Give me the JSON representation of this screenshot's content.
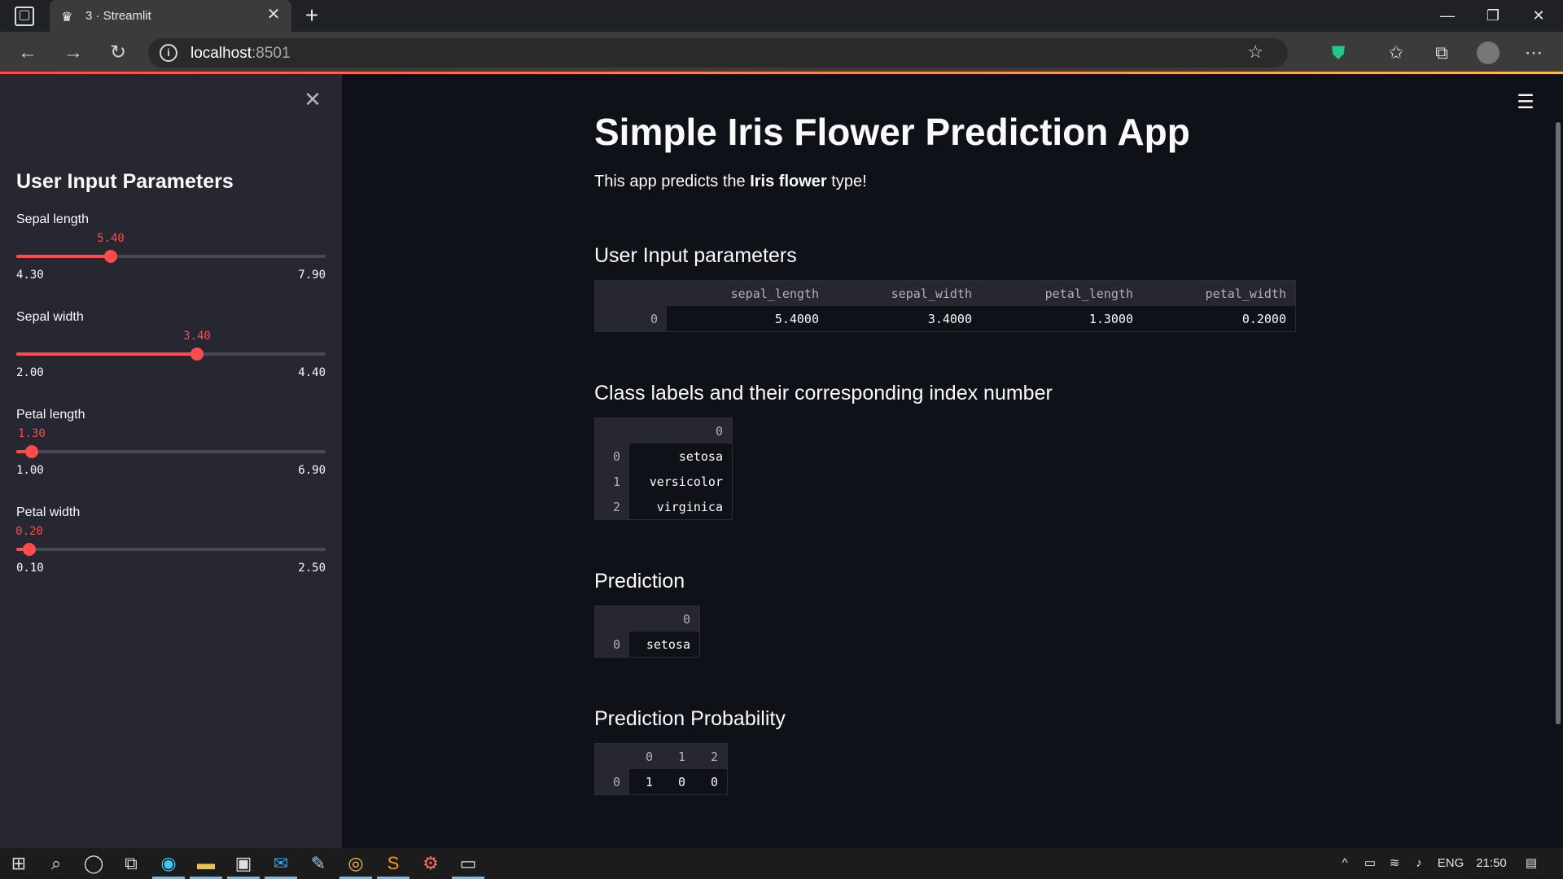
{
  "browser": {
    "tab_title": "3 · Streamlit",
    "url_host": "localhost",
    "url_port": ":8501"
  },
  "sidebar": {
    "title": "User Input Parameters",
    "sliders": [
      {
        "label": "Sepal length",
        "value": "5.40",
        "min": "4.30",
        "max": "7.90",
        "fraction": 0.306
      },
      {
        "label": "Sepal width",
        "value": "3.40",
        "min": "2.00",
        "max": "4.40",
        "fraction": 0.583
      },
      {
        "label": "Petal length",
        "value": "1.30",
        "min": "1.00",
        "max": "6.90",
        "fraction": 0.051
      },
      {
        "label": "Petal width",
        "value": "0.20",
        "min": "0.10",
        "max": "2.50",
        "fraction": 0.042
      }
    ]
  },
  "main": {
    "title": "Simple Iris Flower Prediction App",
    "intro_pre": "This app predicts the ",
    "intro_bold": "Iris flower",
    "intro_post": " type!",
    "sections": {
      "input_params": "User Input parameters",
      "class_labels": "Class labels and their corresponding index number",
      "prediction": "Prediction",
      "probability": "Prediction Probability"
    },
    "input_table": {
      "columns": [
        "sepal_length",
        "sepal_width",
        "petal_length",
        "petal_width"
      ],
      "rows": [
        {
          "index": "0",
          "values": [
            "5.4000",
            "3.4000",
            "1.3000",
            "0.2000"
          ]
        }
      ]
    },
    "class_table": {
      "columns": [
        "0"
      ],
      "rows": [
        {
          "index": "0",
          "values": [
            "setosa"
          ]
        },
        {
          "index": "1",
          "values": [
            "versicolor"
          ]
        },
        {
          "index": "2",
          "values": [
            "virginica"
          ]
        }
      ]
    },
    "prediction_table": {
      "columns": [
        "0"
      ],
      "rows": [
        {
          "index": "0",
          "values": [
            "setosa"
          ]
        }
      ]
    },
    "probability_table": {
      "columns": [
        "0",
        "1",
        "2"
      ],
      "rows": [
        {
          "index": "0",
          "values": [
            "1",
            "0",
            "0"
          ]
        }
      ]
    }
  },
  "taskbar": {
    "language": "ENG",
    "time": "21:50"
  },
  "colors": {
    "accent": "#ff4b4b",
    "background": "#0e1117",
    "sidebar": "#262730"
  }
}
